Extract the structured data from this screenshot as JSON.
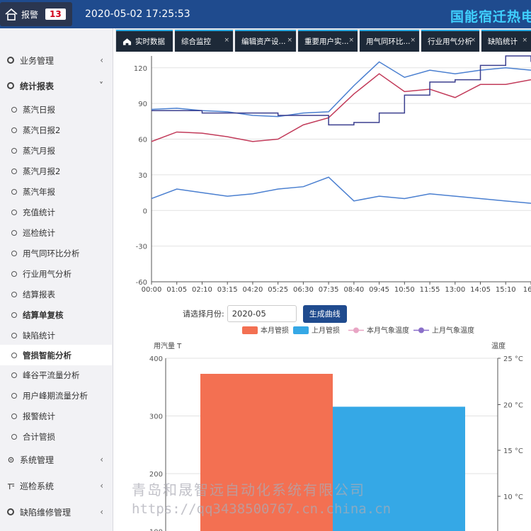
{
  "header": {
    "alarm_label": "报警",
    "alarm_count": "13",
    "datetime": "2020-05-02 17:25:53",
    "brand": "国能宿迁热电"
  },
  "sidebar": {
    "groups": [
      {
        "label": "业务管理",
        "arrow": "‹"
      },
      {
        "label": "统计报表",
        "arrow": "˅"
      },
      {
        "label": "系统管理",
        "arrow": "‹"
      },
      {
        "label": "巡检系统",
        "arrow": "‹"
      },
      {
        "label": "缺陷维修管理",
        "arrow": "‹"
      }
    ],
    "items": [
      {
        "label": "蒸汽日报"
      },
      {
        "label": "蒸汽日报2"
      },
      {
        "label": "蒸汽月报"
      },
      {
        "label": "蒸汽月报2"
      },
      {
        "label": "蒸汽年报"
      },
      {
        "label": "充值统计"
      },
      {
        "label": "巡检统计"
      },
      {
        "label": "用气同环比分析"
      },
      {
        "label": "行业用气分析"
      },
      {
        "label": "结算报表"
      },
      {
        "label": "结算单复核"
      },
      {
        "label": "缺陷统计"
      },
      {
        "label": "管损智能分析"
      },
      {
        "label": "峰谷平流量分析"
      },
      {
        "label": "用户峰期流量分析"
      },
      {
        "label": "报警统计"
      },
      {
        "label": "合计管损"
      }
    ]
  },
  "tabs": [
    {
      "label": "实时数据",
      "close": ""
    },
    {
      "label": "综合监控",
      "close": "×"
    },
    {
      "label": "编辑资产设...",
      "close": "×"
    },
    {
      "label": "重要用户实...",
      "close": "×"
    },
    {
      "label": "用气同环比...",
      "close": "×"
    },
    {
      "label": "行业用气分析",
      "close": "×"
    },
    {
      "label": "缺陷统计",
      "close": "×"
    }
  ],
  "month_picker": {
    "label": "请选择月份:",
    "value": "2020-05",
    "button": "生成曲线"
  },
  "colors": {
    "topbar": "#1f4b8e",
    "blue_line": "#4a7fd0",
    "red_line": "#c23b5a",
    "navy_line": "#3b3f8f",
    "bar_this_month": "#f37052",
    "bar_last_month": "#35a8e6"
  },
  "chart_data": [
    {
      "type": "line",
      "x_ticks": [
        "00:00",
        "01:05",
        "02:10",
        "03:15",
        "04:20",
        "05:25",
        "06:30",
        "07:35",
        "08:40",
        "09:45",
        "10:50",
        "11:55",
        "13:00",
        "14:05",
        "15:10",
        "16:1"
      ],
      "y_ticks": [
        120,
        90,
        60,
        30,
        0,
        -30,
        -60
      ],
      "ylim": [
        -60,
        130
      ],
      "x": [
        0,
        1,
        2,
        3,
        4,
        5,
        6,
        7,
        8,
        9,
        10,
        11,
        12,
        13,
        14,
        15
      ],
      "series": [
        {
          "values": [
            85,
            86,
            84,
            83,
            80,
            79,
            82,
            83,
            105,
            125,
            112,
            118,
            115,
            118,
            120,
            118
          ]
        },
        {
          "values": [
            58,
            66,
            65,
            62,
            58,
            60,
            72,
            78,
            98,
            115,
            100,
            102,
            95,
            106,
            106,
            110
          ]
        },
        {
          "values": [
            84,
            84,
            82,
            82,
            82,
            80,
            80,
            72,
            74,
            82,
            97,
            108,
            110,
            122,
            130,
            125
          ]
        },
        {
          "values": [
            10,
            18,
            15,
            12,
            14,
            18,
            20,
            28,
            8,
            12,
            10,
            14,
            12,
            10,
            8,
            6
          ]
        }
      ]
    },
    {
      "type": "bar",
      "legend": [
        "本月管损",
        "上月管损",
        "本月气象温度",
        "上月气象温度"
      ],
      "ylabel_left": "用汽量 T",
      "ylabel_right": "温度",
      "y_ticks_left": [
        400,
        300,
        200,
        100
      ],
      "y_ticks_right": [
        "25 °C",
        "20 °C",
        "15 °C",
        "10 °C"
      ],
      "ylim": [
        100,
        400
      ],
      "values": [
        373,
        316
      ]
    }
  ],
  "watermark": {
    "line1": "青岛和晟智远自动化系统有限公司",
    "line2": "https://qq3438500767.cn.china.cn"
  }
}
